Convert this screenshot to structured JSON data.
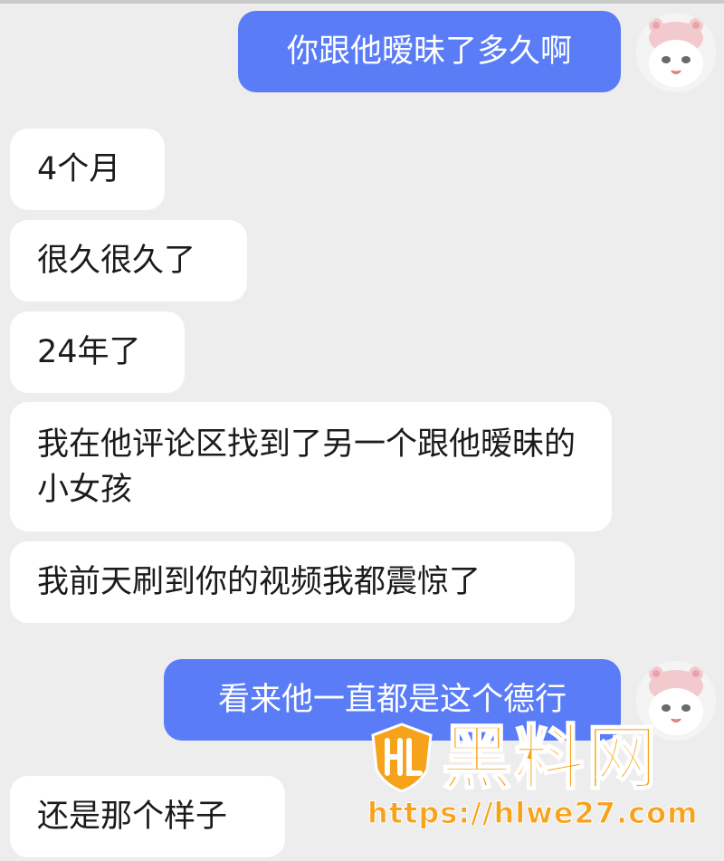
{
  "messages": [
    {
      "side": "outgoing",
      "text": "你跟他暧昧了多久啊"
    },
    {
      "side": "incoming",
      "text": "4个月"
    },
    {
      "side": "incoming",
      "text": "很久很久了"
    },
    {
      "side": "incoming",
      "text": "24年了"
    },
    {
      "side": "incoming",
      "text": "我在他评论区找到了另一个跟他暧昧的小女孩"
    },
    {
      "side": "incoming",
      "text": "我前天刷到你的视频我都震惊了"
    },
    {
      "side": "outgoing",
      "text": "看来他一直都是这个德行"
    },
    {
      "side": "incoming",
      "text": "还是那个样子"
    }
  ],
  "watermark": {
    "title": "黑料网",
    "url": "https://hlwe27.com"
  },
  "colors": {
    "background": "#ededed",
    "incoming_bubble": "#ffffff",
    "outgoing_bubble": "#5a7cf7",
    "watermark": "#f7a21b"
  },
  "icons": {
    "avatar": "hamster-in-pink-hat-icon",
    "watermark_logo": "hl-shield-logo-icon"
  }
}
